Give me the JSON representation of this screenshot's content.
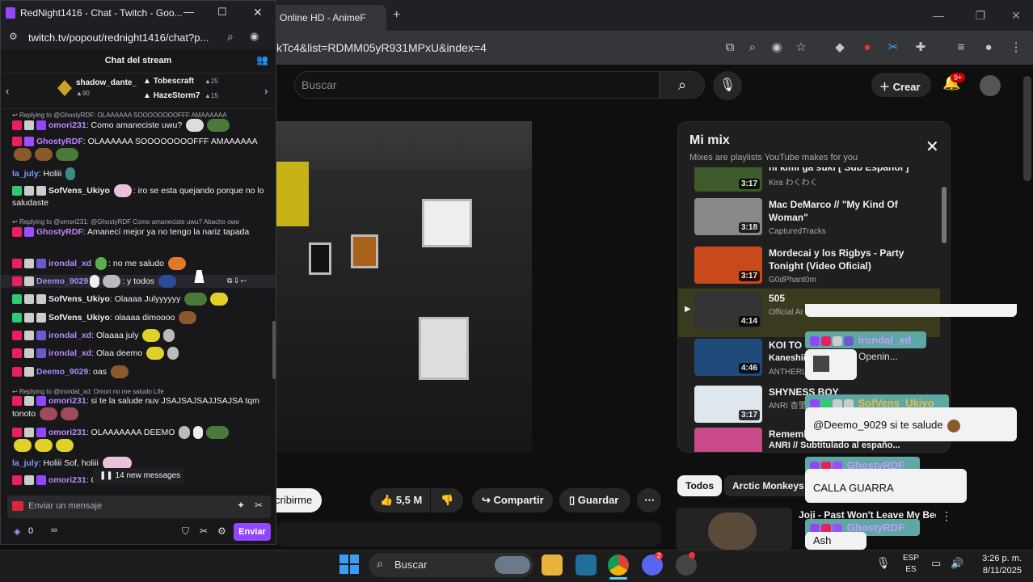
{
  "youtube": {
    "tab_title": "Online HD - AnimeF",
    "url": "kTc4&list=RDMM05yR931MPxU&index=4",
    "search_placeholder": "Buscar",
    "create_label": "Crear",
    "notif_count": "9+",
    "subscribe_label": "cribirme",
    "likes": "5,5 M",
    "share_label": "Compartir",
    "save_label": "Guardar",
    "chips": [
      "Todos",
      "Arctic Monkeys"
    ],
    "rec_title": "Joji - Past Won't Leave My Bed (C",
    "mix": {
      "title": "Mi mix",
      "subtitle": "Mixes are playlists YouTube makes for you",
      "items": [
        {
          "title": "hi kimi ga suki [ Sub Español ]",
          "channel": "Kira わくわく",
          "duration": "3:17"
        },
        {
          "title": "Mac DeMarco // \"My Kind Of Woman\"",
          "channel": "CapturedTracks",
          "duration": "3:18"
        },
        {
          "title": "Mordecai y los Rigbys - Party Tonight (Video Oficial)",
          "channel": "G0dPhant0m",
          "duration": "3:17"
        },
        {
          "title": "505",
          "channel": "Official Ar",
          "duration": "4:14"
        },
        {
          "title": "KOI TO U",
          "channel": "ANTHERL",
          "subline": "Kaneshii",
          "duration": "4:46"
        },
        {
          "title": "SHYNESS BOY",
          "channel": "ANRI 杏里",
          "duration": "3:17"
        },
        {
          "title": "Rememb",
          "channel": "ANRI // Subtitulado al españo...",
          "duration": ""
        }
      ]
    }
  },
  "overlay": {
    "messages": [
      {
        "user": "irondal_xd",
        "text": ""
      },
      {
        "user": "SofVens_Ukiyo",
        "text": "@Deemo_9029 si te salude"
      },
      {
        "user": "GhostyRDF",
        "text": "CALLA GUARRA"
      },
      {
        "user": "GhostyRDF",
        "text": "Ash"
      }
    ],
    "partial_text": "Openin..."
  },
  "chat": {
    "window_title": "RedNight1416 - Chat - Twitch - Goo...",
    "url": "twitch.tv/popout/rednight1416/chat?p...",
    "header_title": "Chat del stream",
    "leaderboard": [
      {
        "name": "shadow_dante_",
        "score": "90"
      },
      {
        "name": "Tobescraft",
        "score": "25"
      },
      {
        "name": "HazeStorm7",
        "score": "15"
      }
    ],
    "messages": [
      {
        "reply": "Replying to @GhostyRDF: OLAAAAAA SOOOOOOOOFFF AMAAAAAA"
      },
      {
        "user": "omori231",
        "color": "#b58cff",
        "text": ": Como amaneciste uwu?"
      },
      {
        "user": "GhostyRDF",
        "color": "#c084fc",
        "text": ": OLAAAAAA SOOOOOOOOFFF AMAAAAAA"
      },
      {
        "user": "la_july",
        "color": "#7c9cff",
        "text": ": Holiii"
      },
      {
        "user": "SofVens_Ukiyo",
        "color": "#f1f1f1",
        "text": ": iro se esta quejando porque no lo saludaste"
      },
      {
        "reply": "Replying to @omori231: @GhostyRDF Como amaneciste uwu? Abacho owo"
      },
      {
        "user": "GhostyRDF",
        "color": "#c084fc",
        "text": ": Amanecí mejor      ya no tengo la nariz tapada"
      },
      {
        "user": "irondal_xd",
        "color": "#b58cff",
        "text": ": no me saludo"
      },
      {
        "user": "Deemo_9029",
        "color": "#a78bfa",
        "text": ": y todos"
      },
      {
        "user": "SofVens_Ukiyo",
        "color": "#f1f1f1",
        "text": ": Olaaaa Julyyyyyy"
      },
      {
        "user": "SofVens_Ukiyo",
        "color": "#f1f1f1",
        "text": ": olaaaa dimoooo"
      },
      {
        "user": "irondal_xd",
        "color": "#b58cff",
        "text": ": Olaaaa july"
      },
      {
        "user": "irondal_xd",
        "color": "#b58cff",
        "text": ": Olaa deemo"
      },
      {
        "user": "Deemo_9029",
        "color": "#a78bfa",
        "text": ": oas"
      },
      {
        "reply": "Replying to @irondal_xd: Omori no me saludo Life"
      },
      {
        "user": "omori231",
        "color": "#b58cff",
        "text": ": si te la salude nuv JSAJSAJSAJJSAJSA tqm tonoto"
      },
      {
        "user": "omori231",
        "color": "#b58cff",
        "text": ": OLAAAAAAA DEEMO"
      },
      {
        "user": "la_july",
        "color": "#7c9cff",
        "text": ": Holiii Sof, holiii"
      },
      {
        "user": "omori231",
        "color": "#b58cff",
        "text": ": O"
      }
    ],
    "new_messages": "14 new messages",
    "input_placeholder": "Enviar un mensaje",
    "points": "0",
    "send_label": "Enviar"
  },
  "taskbar": {
    "search_placeholder": "Buscar",
    "lang_top": "ESP",
    "lang_bottom": "ES",
    "time": "3:26 p. m.",
    "date": "8/11/2025",
    "discord_badge": "2"
  },
  "colors": {
    "twitch_purple": "#9147ff",
    "youtube_red": "#cc0000",
    "overlay_tag": "#5ea7a3"
  }
}
